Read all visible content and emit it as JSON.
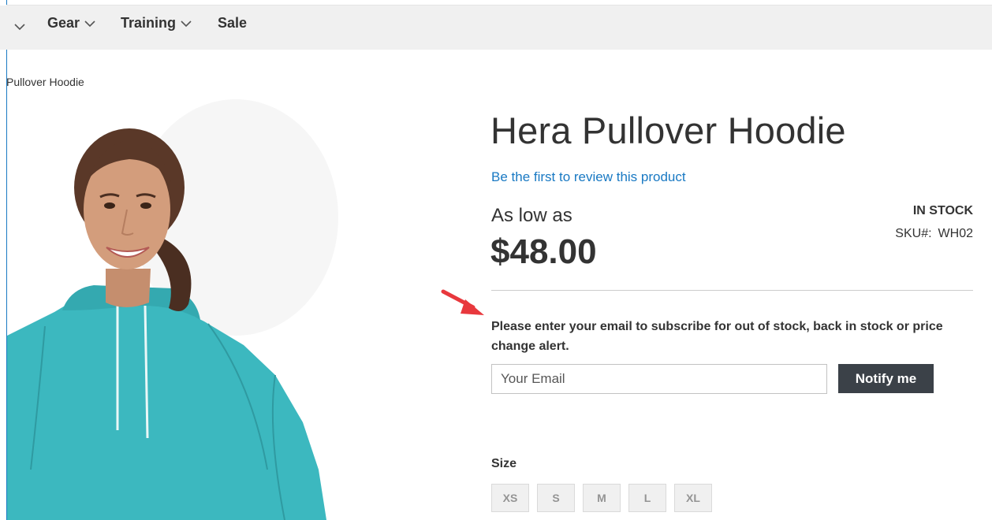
{
  "nav": {
    "items": [
      {
        "label": "Gear"
      },
      {
        "label": "Training"
      },
      {
        "label": "Sale"
      }
    ]
  },
  "breadcrumb": {
    "current": "Pullover Hoodie"
  },
  "product": {
    "title": "Hera Pullover Hoodie",
    "review_link": "Be the first to review this product",
    "price_prefix": "As low as",
    "price": "$48.00",
    "stock": "IN STOCK",
    "sku_label": "SKU#:",
    "sku": "WH02"
  },
  "alert": {
    "message": "Please enter your email to subscribe for out of stock, back in stock or price change alert.",
    "email_placeholder": "Your Email",
    "button_label": "Notify me"
  },
  "options": {
    "size_label": "Size",
    "sizes": [
      "XS",
      "S",
      "M",
      "L",
      "XL"
    ]
  },
  "colors": {
    "accent_link": "#1979c3",
    "button_dark": "#3b4148",
    "hoodie": "#3cb8bf",
    "annotation_arrow": "#e8383d"
  }
}
